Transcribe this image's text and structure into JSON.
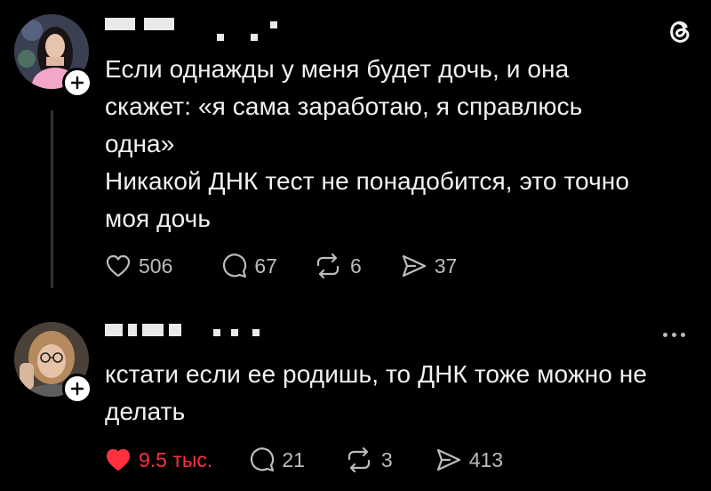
{
  "post1": {
    "lines": [
      "Если однажды у меня будет дочь, и она",
      "скажет: «я сама заработаю, я справлюсь",
      "одна»",
      "Никакой ДНК тест не понадобится, это точно",
      "моя дочь"
    ],
    "likes": "506",
    "replies": "67",
    "reposts": "6",
    "shares": "37"
  },
  "post2": {
    "lines": [
      "кстати если ее родишь, то ДНК тоже можно не",
      "делать"
    ],
    "likes": "9.5 тыс.",
    "replies": "21",
    "reposts": "3",
    "shares": "413"
  },
  "icons": [
    "threads-logo-icon",
    "heart-icon",
    "comment-icon",
    "repost-icon",
    "share-icon",
    "more-icon",
    "plus-icon"
  ],
  "colors": {
    "background": "#000000",
    "text": "#f1f1f1",
    "muted": "#bcbcbc",
    "like": "#ff3040"
  }
}
